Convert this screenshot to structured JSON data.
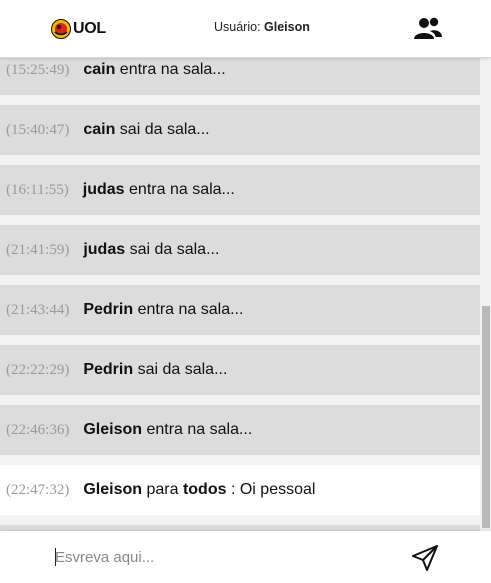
{
  "header": {
    "logo_text": "UOL",
    "user_prefix": "Usuário:",
    "user_name": "Gleison",
    "people_icon": "people-icon"
  },
  "messages": [
    {
      "time": "(15:25:49)",
      "user": "cain",
      "text": "entra na sala...",
      "type": "status"
    },
    {
      "time": "(15:40:47)",
      "user": "cain",
      "text": "sai da sala...",
      "type": "status"
    },
    {
      "time": "(16:11:55)",
      "user": "judas",
      "text": "entra na sala...",
      "type": "status"
    },
    {
      "time": "(21:41:59)",
      "user": "judas",
      "text": "sai da sala...",
      "type": "status"
    },
    {
      "time": "(21:43:44)",
      "user": "Pedrin",
      "text": "entra na sala...",
      "type": "status"
    },
    {
      "time": "(22:22:29)",
      "user": "Pedrin",
      "text": "sai da sala...",
      "type": "status"
    },
    {
      "time": "(22:46:36)",
      "user": "Gleison",
      "text": "entra na sala...",
      "type": "status"
    },
    {
      "time": "(22:47:32)",
      "user": "Gleison",
      "to_word": "para",
      "to": "todos",
      "text": ": Oi pessoal",
      "type": "message"
    }
  ],
  "footer": {
    "placeholder": "Esvreva aqui...",
    "send_icon": "send-icon"
  },
  "colors": {
    "status_bg": "#dcdcdc",
    "message_bg": "#ffffff",
    "time": "#9a9a9a"
  }
}
